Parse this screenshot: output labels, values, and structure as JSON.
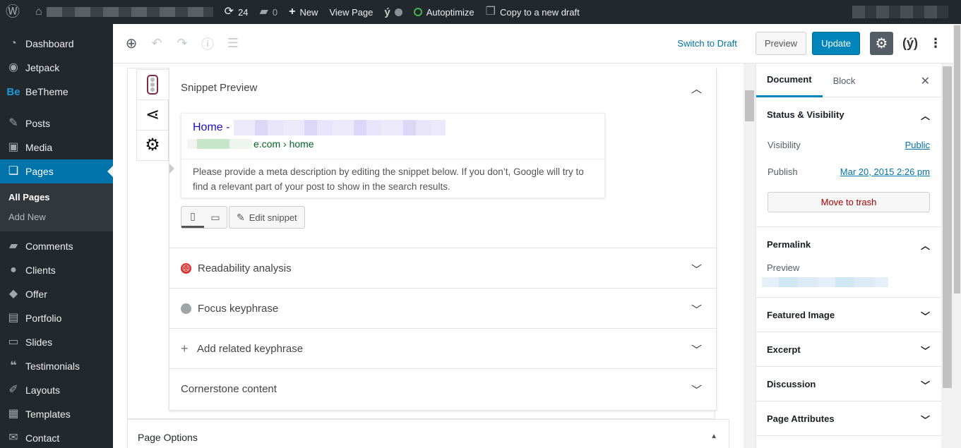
{
  "adminbar": {
    "updates_count": "24",
    "comments_count": "0",
    "new_label": "New",
    "view_page_label": "View Page",
    "autoptimize_label": "Autoptimize",
    "copy_draft_label": "Copy to a new draft"
  },
  "menu": {
    "items_top": [
      {
        "label": "Dashboard",
        "icon": "dashboard-icon"
      },
      {
        "label": "Jetpack",
        "icon": "jetpack-icon"
      },
      {
        "label": "BeTheme",
        "icon": "betheme-icon"
      }
    ],
    "items_mid": [
      {
        "label": "Posts",
        "icon": "pin-icon"
      },
      {
        "label": "Media",
        "icon": "media-icon"
      },
      {
        "label": "Pages",
        "icon": "pages-icon"
      }
    ],
    "submenu": [
      "All Pages",
      "Add New"
    ],
    "items_bottom": [
      {
        "label": "Comments",
        "icon": "comments-icon"
      },
      {
        "label": "Clients",
        "icon": "clients-icon"
      },
      {
        "label": "Offer",
        "icon": "offer-icon"
      },
      {
        "label": "Portfolio",
        "icon": "portfolio-icon"
      },
      {
        "label": "Slides",
        "icon": "slides-icon"
      },
      {
        "label": "Testimonials",
        "icon": "testimonials-icon"
      },
      {
        "label": "Layouts",
        "icon": "layouts-icon"
      },
      {
        "label": "Templates",
        "icon": "templates-icon"
      },
      {
        "label": "Contact",
        "icon": "contact-icon"
      }
    ]
  },
  "header": {
    "switch_to_draft": "Switch to Draft",
    "preview": "Preview",
    "update": "Update"
  },
  "yoast": {
    "snippet_preview_title": "Snippet Preview",
    "snippet_title_prefix": "Home -",
    "snippet_url_suffix": "e.com › home",
    "snippet_description": "Please provide a meta description by editing the snippet below. If you don’t, Google will try to find a relevant part of your post to show in the search results.",
    "edit_snippet": "Edit snippet",
    "readability": "Readability analysis",
    "focus_keyphrase": "Focus keyphrase",
    "add_related": "Add related keyphrase",
    "cornerstone": "Cornerstone content"
  },
  "page_options": "Page Options",
  "sidebar": {
    "tab_document": "Document",
    "tab_block": "Block",
    "status_visibility": "Status & Visibility",
    "visibility_label": "Visibility",
    "visibility_value": "Public",
    "publish_label": "Publish",
    "publish_value": "Mar 20, 2015 2:26 pm",
    "move_to_trash": "Move to trash",
    "permalink": "Permalink",
    "permalink_preview": "Preview",
    "featured_image": "Featured Image",
    "excerpt": "Excerpt",
    "discussion": "Discussion",
    "page_attributes": "Page Attributes"
  },
  "colors": {
    "admin_dark": "#23282d",
    "accent_blue": "#0073aa",
    "primary_button": "#0085ba",
    "snippet_title": "#1e0fbe",
    "snippet_url": "#006621"
  }
}
